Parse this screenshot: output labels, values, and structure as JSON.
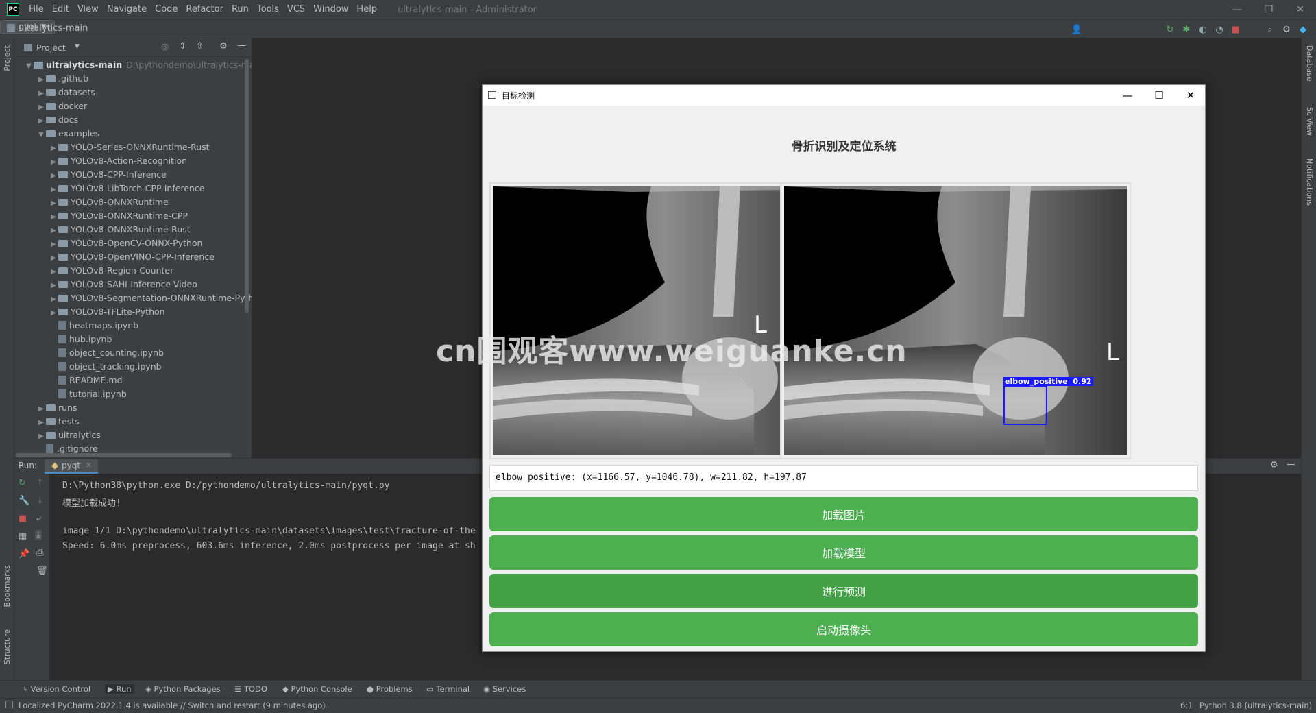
{
  "ide": {
    "logo": "PC",
    "menu": [
      "File",
      "Edit",
      "View",
      "Navigate",
      "Code",
      "Refactor",
      "Run",
      "Tools",
      "VCS",
      "Window",
      "Help"
    ],
    "window_title": "ultralytics-main - Administrator",
    "breadcrumb": "ultralytics-main",
    "run_config": "pyqt"
  },
  "project": {
    "header": "Project",
    "root": {
      "name": "ultralytics-main",
      "path": "D:\\pythondemo\\ultralytics-main"
    },
    "tree": [
      {
        "label": ".github",
        "depth": 1,
        "kind": "folder",
        "expanded": false
      },
      {
        "label": "datasets",
        "depth": 1,
        "kind": "folder",
        "expanded": false
      },
      {
        "label": "docker",
        "depth": 1,
        "kind": "folder",
        "expanded": false
      },
      {
        "label": "docs",
        "depth": 1,
        "kind": "folder",
        "expanded": false
      },
      {
        "label": "examples",
        "depth": 1,
        "kind": "folder",
        "expanded": true
      },
      {
        "label": "YOLO-Series-ONNXRuntime-Rust",
        "depth": 2,
        "kind": "folder",
        "expanded": false
      },
      {
        "label": "YOLOv8-Action-Recognition",
        "depth": 2,
        "kind": "folder",
        "expanded": false
      },
      {
        "label": "YOLOv8-CPP-Inference",
        "depth": 2,
        "kind": "folder",
        "expanded": false
      },
      {
        "label": "YOLOv8-LibTorch-CPP-Inference",
        "depth": 2,
        "kind": "folder",
        "expanded": false
      },
      {
        "label": "YOLOv8-ONNXRuntime",
        "depth": 2,
        "kind": "folder",
        "expanded": false
      },
      {
        "label": "YOLOv8-ONNXRuntime-CPP",
        "depth": 2,
        "kind": "folder",
        "expanded": false
      },
      {
        "label": "YOLOv8-ONNXRuntime-Rust",
        "depth": 2,
        "kind": "folder",
        "expanded": false
      },
      {
        "label": "YOLOv8-OpenCV-ONNX-Python",
        "depth": 2,
        "kind": "folder",
        "expanded": false
      },
      {
        "label": "YOLOv8-OpenVINO-CPP-Inference",
        "depth": 2,
        "kind": "folder",
        "expanded": false
      },
      {
        "label": "YOLOv8-Region-Counter",
        "depth": 2,
        "kind": "folder",
        "expanded": false
      },
      {
        "label": "YOLOv8-SAHI-Inference-Video",
        "depth": 2,
        "kind": "folder",
        "expanded": false
      },
      {
        "label": "YOLOv8-Segmentation-ONNXRuntime-Python",
        "depth": 2,
        "kind": "folder",
        "expanded": false
      },
      {
        "label": "YOLOv8-TFLite-Python",
        "depth": 2,
        "kind": "folder",
        "expanded": false
      },
      {
        "label": "heatmaps.ipynb",
        "depth": 2,
        "kind": "file"
      },
      {
        "label": "hub.ipynb",
        "depth": 2,
        "kind": "file"
      },
      {
        "label": "object_counting.ipynb",
        "depth": 2,
        "kind": "file"
      },
      {
        "label": "object_tracking.ipynb",
        "depth": 2,
        "kind": "file"
      },
      {
        "label": "README.md",
        "depth": 2,
        "kind": "file"
      },
      {
        "label": "tutorial.ipynb",
        "depth": 2,
        "kind": "file"
      },
      {
        "label": "runs",
        "depth": 1,
        "kind": "folder",
        "expanded": false
      },
      {
        "label": "tests",
        "depth": 1,
        "kind": "folder",
        "expanded": false
      },
      {
        "label": "ultralytics",
        "depth": 1,
        "kind": "folder",
        "expanded": false
      },
      {
        "label": ".gitignore",
        "depth": 1,
        "kind": "file"
      }
    ]
  },
  "left_stripe": {
    "project": "Project",
    "bookmarks": "Bookmarks",
    "structure": "Structure"
  },
  "right_stripe": {
    "database": "Database",
    "sciview": "SciView",
    "notifications": "Notifications"
  },
  "run": {
    "label": "Run:",
    "tab": "pyqt",
    "lines": [
      "D:\\Python38\\python.exe D:/pythondemo/ultralytics-main/pyqt.py",
      "模型加载成功!",
      "",
      "image 1/1 D:\\pythondemo\\ultralytics-main\\datasets\\images\\test\\fracture-of-the",
      "Speed: 6.0ms preprocess, 603.6ms inference, 2.0ms postprocess per image at sh"
    ]
  },
  "bottom_tabs": [
    "Version Control",
    "Run",
    "Python Packages",
    "TODO",
    "Python Console",
    "Problems",
    "Terminal",
    "Services"
  ],
  "status": {
    "message": "Localized PyCharm 2022.1.4 is available // Switch and restart (9 minutes ago)",
    "position": "6:1",
    "interpreter": "Python 3.8 (ultralytics-main)"
  },
  "app_window": {
    "title": "目标检测",
    "heading": "骨折识别及定位系统",
    "image_marker": "L",
    "detection_label": "elbow_positive  0.92",
    "result_text": "elbow positive: (x=1166.57, y=1046.78), w=211.82, h=197.87",
    "buttons": [
      "加载图片",
      "加载模型",
      "进行预测",
      "启动摄像头"
    ],
    "button_color": "#4caf50",
    "box_color": "#1a1aff"
  },
  "watermark": "cn围观客www.weiguanke.cn"
}
